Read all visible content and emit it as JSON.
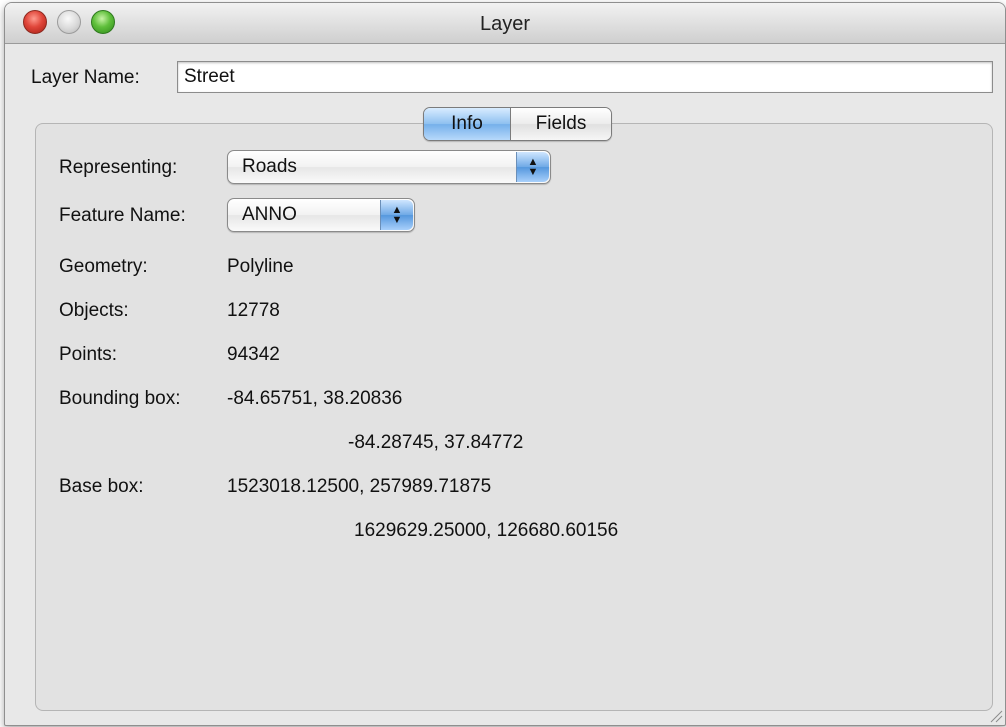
{
  "window": {
    "title": "Layer"
  },
  "layer_name": {
    "label": "Layer Name:",
    "value": "Street"
  },
  "tabs": [
    {
      "label": "Info",
      "selected": true
    },
    {
      "label": "Fields",
      "selected": false
    }
  ],
  "representing": {
    "label": "Representing:",
    "value": "Roads"
  },
  "feature_name": {
    "label": "Feature Name:",
    "value": "ANNO"
  },
  "geometry": {
    "label": "Geometry:",
    "value": "Polyline"
  },
  "objects": {
    "label": "Objects:",
    "value": "12778"
  },
  "points": {
    "label": "Points:",
    "value": "94342"
  },
  "bounding_box": {
    "label": "Bounding box:",
    "line1": "-84.65751, 38.20836",
    "line2": "-84.28745, 37.84772"
  },
  "base_box": {
    "label": "Base box:",
    "line1": "1523018.12500, 257989.71875",
    "line2": "1629629.25000, 126680.60156"
  },
  "colors": {
    "accent": "#75b0ea",
    "window_bg": "#e8e8e8"
  }
}
